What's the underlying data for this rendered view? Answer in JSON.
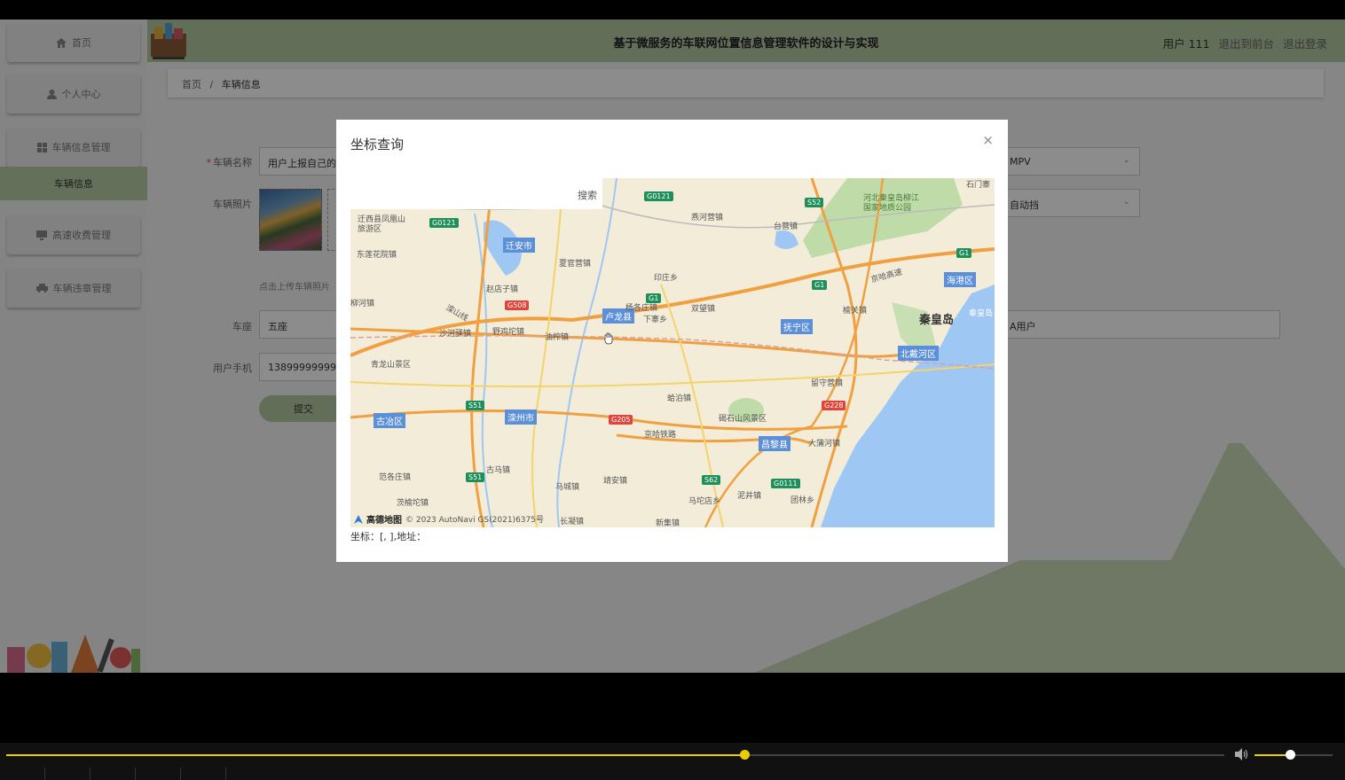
{
  "header": {
    "title": "基于微服务的车联网位置信息管理软件的设计与实现",
    "user": "用户 111",
    "to_front": "退出到前台",
    "logout": "退出登录"
  },
  "sidebar": {
    "items": [
      {
        "label": "首页",
        "icon": "home-icon"
      },
      {
        "label": "个人中心",
        "icon": "user-icon"
      },
      {
        "label": "车辆信息管理",
        "icon": "grid-icon"
      },
      {
        "label": "车辆信息",
        "icon": ""
      },
      {
        "label": "高速收费管理",
        "icon": "monitor-icon"
      },
      {
        "label": "车辆违章管理",
        "icon": "car-icon"
      }
    ]
  },
  "breadcrumb": {
    "home": "首页",
    "sep": "/",
    "current": "车辆信息"
  },
  "form": {
    "name_label": "车辆名称",
    "name_value": "用户上报自己的",
    "type_value": "MPV",
    "photo_label": "车辆照片",
    "gear_value": "自动挡",
    "upload_tip": "点击上传车辆照片",
    "seat_label": "车座",
    "seat_value": "五座",
    "owner_value": "A用户",
    "phone_label": "用户手机",
    "phone_value": "13899999999",
    "submit_label": "提交"
  },
  "dialog": {
    "title": "坐标查询",
    "close": "×",
    "search_label": "搜索",
    "coord_text": "坐标：[, ],地址：",
    "map": {
      "credit_brand": "高德地图",
      "credit": "© 2023 AutoNavi GS(2021)6375号",
      "cities": [
        "迁安市",
        "卢龙县",
        "抚宁区",
        "海港区",
        "北戴河区",
        "古冶区",
        "滦州市",
        "昌黎县"
      ],
      "big_city": "秦皇岛",
      "shields_green": [
        "G0121",
        "G0121",
        "G1",
        "G1",
        "G1",
        "S51",
        "S51",
        "S52",
        "S62",
        "G0111"
      ],
      "shields_red": [
        "G508",
        "G205",
        "G228"
      ],
      "places": [
        "迁西县凤凰山旅游区",
        "东莲花院镇",
        "柳河镇",
        "青龙山景区",
        "夏官营镇",
        "赵店子镇",
        "印庄乡",
        "燕河营镇",
        "台营镇",
        "河北秦皇岛柳江国家地质公园",
        "双望镇",
        "下寨乡",
        "杨各庄镇",
        "榆关镇",
        "野鸡坨镇",
        "油榨镇",
        "沙河驿镇",
        "石门寨",
        "留守营镇",
        "碣石山风景区",
        "蛤泊镇",
        "大蒲河镇",
        "古马镇",
        "马城镇",
        "靖安镇",
        "马坨店乡",
        "泥井镇",
        "团林乡",
        "范各庄镇",
        "茨榆坨镇",
        "长凝镇",
        "新集镇",
        "京哈高速",
        "京哈铁路",
        "滦山线",
        "秦皇岛"
      ]
    }
  },
  "player": {
    "progress": 0.606,
    "volume": 0.45
  }
}
